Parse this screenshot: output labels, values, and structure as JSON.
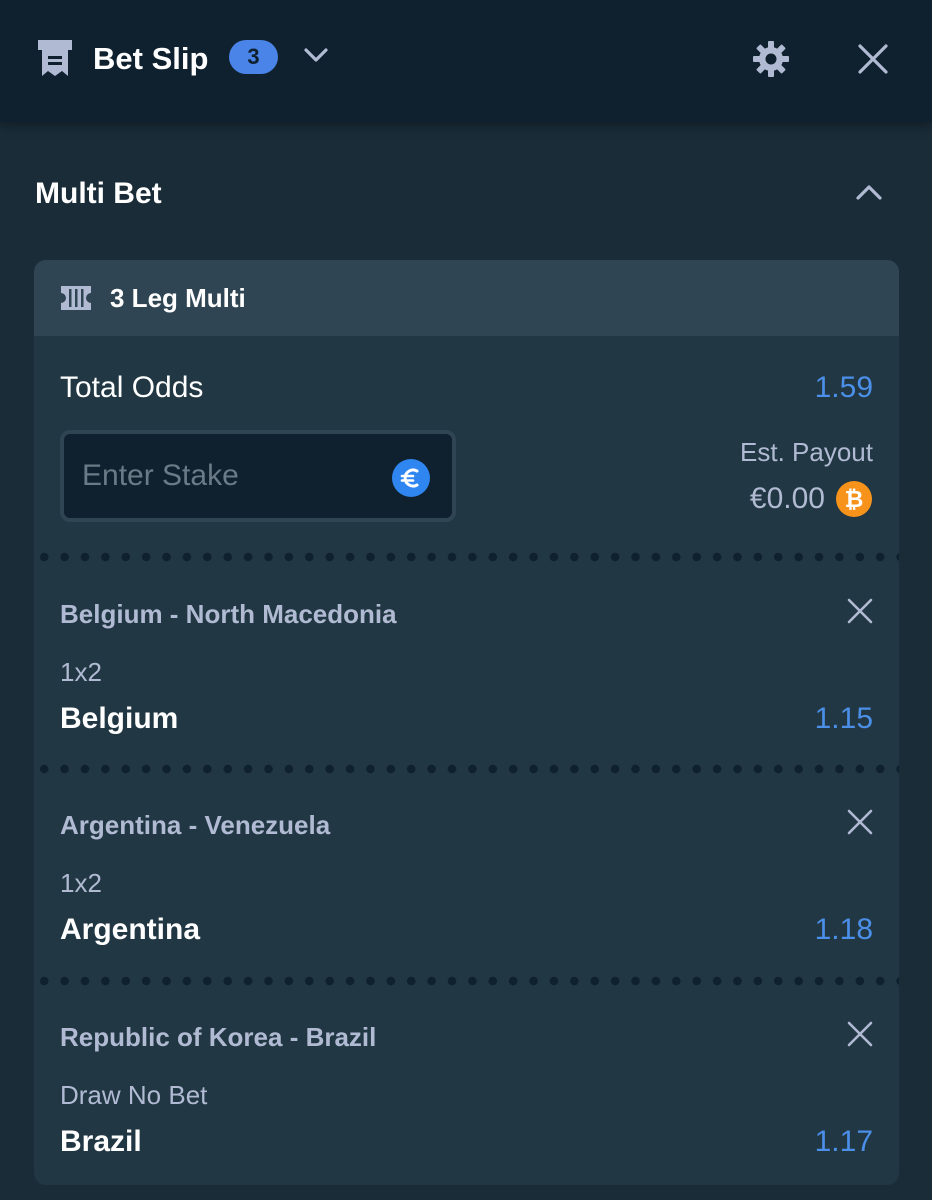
{
  "header": {
    "title": "Bet Slip",
    "count": "3",
    "icons": [
      "ticket-icon",
      "chevron-down-icon",
      "gear-icon",
      "close-icon"
    ]
  },
  "section": {
    "title": "Multi Bet"
  },
  "multi": {
    "label": "3 Leg Multi",
    "total_odds_label": "Total Odds",
    "total_odds_value": "1.59",
    "stake_placeholder": "Enter Stake",
    "stake_value": "",
    "est_payout_label": "Est. Payout",
    "est_payout_value": "€0.00"
  },
  "legs": [
    {
      "event": "Belgium - North Macedonia",
      "market": "1x2",
      "selection": "Belgium",
      "odds": "1.15"
    },
    {
      "event": "Argentina - Venezuela",
      "market": "1x2",
      "selection": "Argentina",
      "odds": "1.18"
    },
    {
      "event": "Republic of Korea - Brazil",
      "market": "Draw No Bet",
      "selection": "Brazil",
      "odds": "1.17"
    }
  ],
  "colors": {
    "background": "#1a2c38",
    "header": "#0f212e",
    "card": "#213743",
    "card_head": "#2f4553",
    "accent_blue": "#4b8fe8",
    "muted_text": "#b1bad3",
    "bitcoin": "#f7931a"
  }
}
